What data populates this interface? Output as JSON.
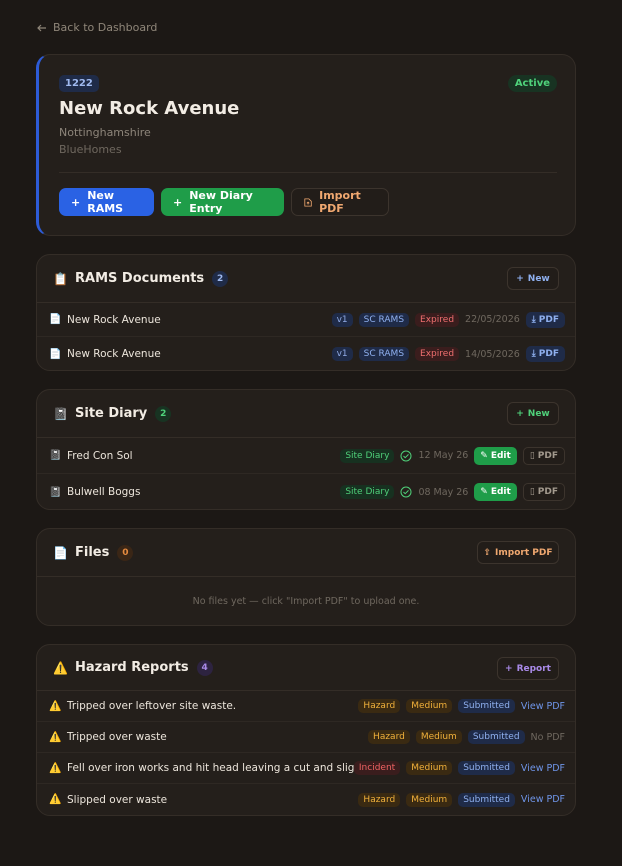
{
  "nav": {
    "back_label": "Back to Dashboard"
  },
  "job": {
    "number": "1222",
    "status": "Active",
    "title": "New Rock Avenue",
    "county": "Nottinghamshire",
    "client": "BlueHomes"
  },
  "actions": {
    "new_rams": "New RAMS",
    "new_diary": "New Diary Entry",
    "import_pdf": "Import PDF"
  },
  "rams": {
    "icon": "clipboard-icon",
    "title": "RAMS Documents",
    "count": "2",
    "new_label": "New",
    "items": [
      {
        "name": "New Rock Avenue",
        "version": "v1",
        "type": "SC RAMS",
        "status": "Expired",
        "date": "22/05/2026",
        "pdf": "PDF"
      },
      {
        "name": "New Rock Avenue",
        "version": "v1",
        "type": "SC RAMS",
        "status": "Expired",
        "date": "14/05/2026",
        "pdf": "PDF"
      }
    ]
  },
  "diary": {
    "icon": "notebook-icon",
    "title": "Site Diary",
    "count": "2",
    "new_label": "New",
    "items": [
      {
        "name": "Fred Con Sol",
        "type": "Site Diary",
        "date": "12 May 26",
        "edit": "Edit",
        "pdf": "PDF"
      },
      {
        "name": "Bulwell Boggs",
        "type": "Site Diary",
        "date": "08 May 26",
        "edit": "Edit",
        "pdf": "PDF"
      }
    ]
  },
  "files": {
    "icon": "document-icon",
    "title": "Files",
    "count": "0",
    "import_label": "Import PDF",
    "empty_text": "No files yet — click \"Import PDF\" to upload one."
  },
  "hazards": {
    "icon": "warning-icon",
    "title": "Hazard Reports",
    "count": "4",
    "report_label": "Report",
    "items": [
      {
        "name": "Tripped over leftover site waste.",
        "type": "Hazard",
        "severity": "Medium",
        "status": "Submitted",
        "link": "View PDF"
      },
      {
        "name": "Tripped over waste",
        "type": "Hazard",
        "severity": "Medium",
        "status": "Submitted",
        "link": "No PDF"
      },
      {
        "name": "Fell over iron works and hit head leaving a cut and slight ...",
        "type": "Incident",
        "severity": "Medium",
        "status": "Submitted",
        "link": "View PDF"
      },
      {
        "name": "Slipped over waste",
        "type": "Hazard",
        "severity": "Medium",
        "status": "Submitted",
        "link": "View PDF"
      }
    ]
  },
  "colors": {
    "background": "#1c1815",
    "card": "#241f1b",
    "accent_blue": "#2a62e4",
    "accent_green": "#1f9d49",
    "accent_orange": "#f0a870",
    "expired_red": "#ef6f6f"
  }
}
